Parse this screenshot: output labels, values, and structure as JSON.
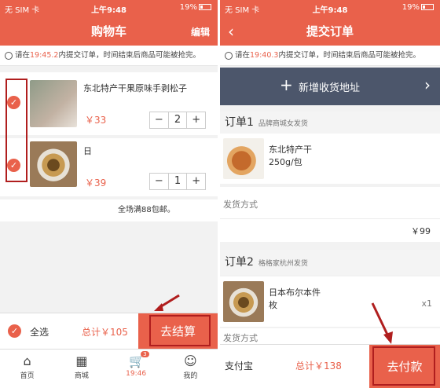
{
  "status": {
    "carrier": "无 SIM 卡",
    "time": "上午9:48",
    "battery": "19%"
  },
  "cart": {
    "title": "购物车",
    "edit": "编辑",
    "notice": {
      "prefix": "请在",
      "time": "19:45.2",
      "suffix": "内提交订单，时间结束后商品可能被抢完。"
    },
    "items": [
      {
        "name": "东北特产干果原味手剥松子",
        "price": "￥33",
        "qty": "2"
      },
      {
        "name": "日",
        "price": "￥39",
        "qty": "1"
      }
    ],
    "promo": "全场满88包邮。",
    "select_all": "全选",
    "total": "总计￥105",
    "checkout": "去结算",
    "tabs": [
      {
        "label": "首页",
        "icon": "home-icon"
      },
      {
        "label": "商城",
        "icon": "grid-icon"
      },
      {
        "label": "19:46",
        "icon": "cart-icon",
        "badge": "3"
      },
      {
        "label": "我的",
        "icon": "user-icon"
      }
    ]
  },
  "order": {
    "title": "提交订单",
    "back": "‹",
    "notice": {
      "prefix": "请在",
      "time": "19:40.3",
      "suffix": "内提交订单，时间结束后商品可能被抢完。"
    },
    "add_address": "新增收货地址",
    "order1": {
      "label": "订单1",
      "seller": "品牌商城女发货",
      "item_name": "东北特产干",
      "item_spec": "250g/包",
      "shipping": "发货方式",
      "amount": "￥99"
    },
    "order2": {
      "label": "订单2",
      "seller": "格格家杭州发货",
      "item_name": "日本布尔本件",
      "item_spec": "枚",
      "qty": "x1",
      "shipping": "发货方式"
    },
    "payment": "支付宝",
    "total": "总计￥138",
    "pay": "去付款"
  },
  "colors": {
    "accent": "#e9614b",
    "annotation": "#b01e1e"
  }
}
